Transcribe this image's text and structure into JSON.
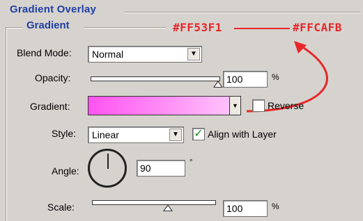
{
  "panel": {
    "title": "Gradient Overlay",
    "group": "Gradient"
  },
  "annotation": {
    "color_start": "#FF53F1",
    "color_end": "#FFCAFB",
    "arrow_color": "#e8262a"
  },
  "blend_mode": {
    "label": "Blend Mode:",
    "value": "Normal"
  },
  "opacity": {
    "label": "Opacity:",
    "value": "100",
    "unit": "%",
    "slider_fraction": 1.0
  },
  "gradient": {
    "label": "Gradient:",
    "start_color": "#FF53F1",
    "end_color": "#FFCAFB",
    "reverse_label": "Reverse",
    "reverse_checked": false
  },
  "style": {
    "label": "Style:",
    "value": "Linear",
    "align_label": "Align with Layer",
    "align_checked": true
  },
  "angle": {
    "label": "Angle:",
    "value": "90",
    "unit": "°"
  },
  "scale": {
    "label": "Scale:",
    "value": "100",
    "unit": "%",
    "slider_fraction": 0.5
  }
}
